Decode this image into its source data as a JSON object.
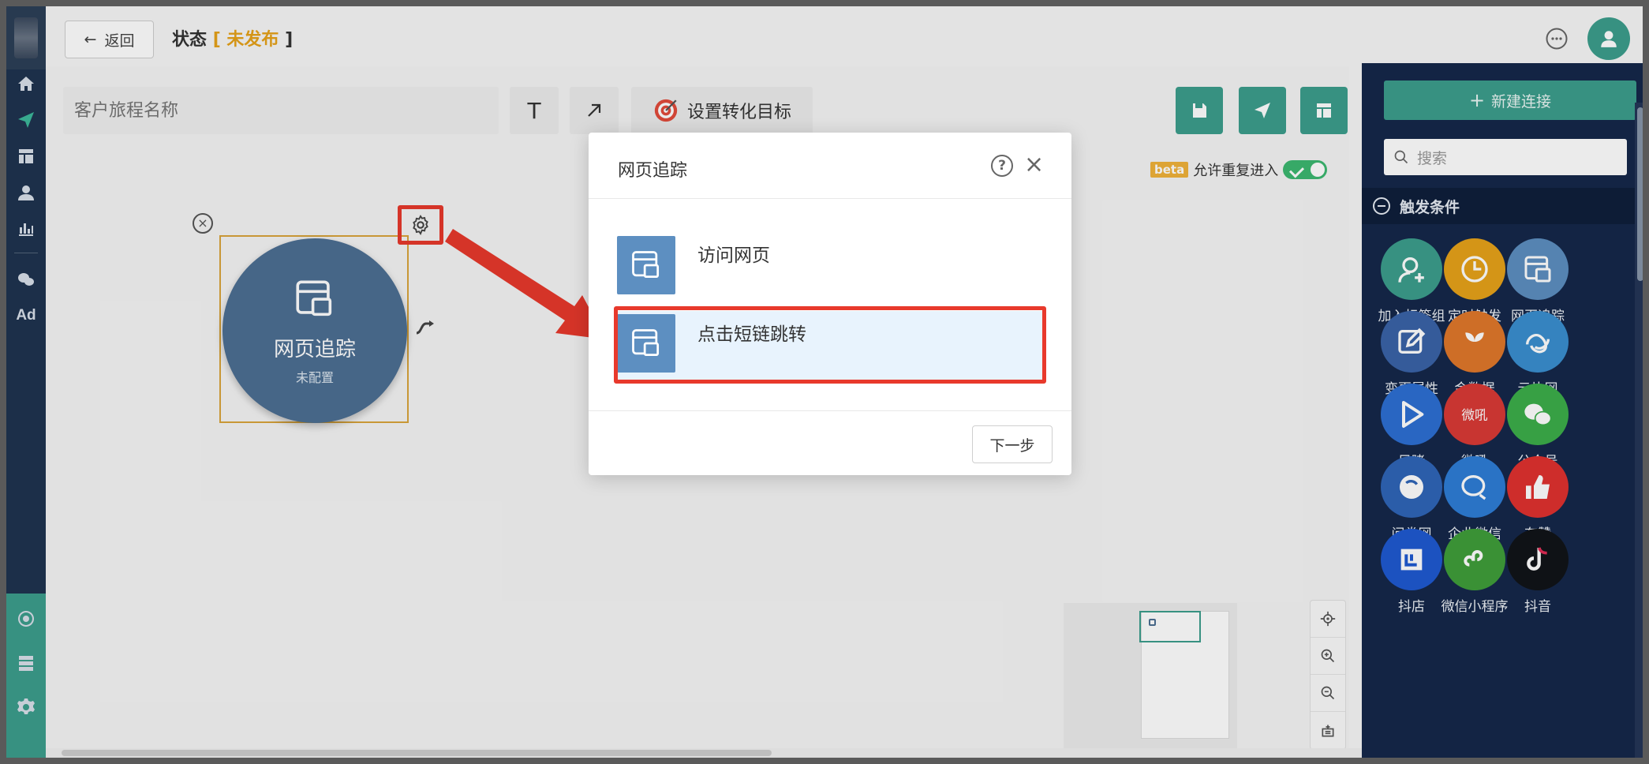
{
  "topbar": {
    "back_label": "返回",
    "status_label": "状态",
    "status_value": "未发布"
  },
  "canvas": {
    "name_placeholder": "客户旅程名称",
    "text_tool": "T",
    "conversion_goal_label": "设置转化目标",
    "beta_label": "beta",
    "allow_reentry_label": "允许重复进入",
    "allow_reentry_on": true,
    "node": {
      "title": "网页追踪",
      "subtitle": "未配置"
    }
  },
  "modal": {
    "title": "网页追踪",
    "options": [
      {
        "label": "访问网页",
        "selected": false
      },
      {
        "label": "点击短链跳转",
        "selected": true
      }
    ],
    "next_label": "下一步"
  },
  "right_panel": {
    "new_connection_label": "新建连接",
    "search_placeholder": "搜索",
    "section_title": "触发条件",
    "tiles": [
      {
        "label": "加入标签组",
        "color": "#3c9e8c",
        "icon": "user-add-icon"
      },
      {
        "label": "定时触发",
        "color": "#e6a21a",
        "icon": "clock-icon"
      },
      {
        "label": "网页追踪",
        "color": "#5d8fc1",
        "icon": "webpage-icon"
      },
      {
        "label": "变更属性",
        "color": "#3a63a8",
        "icon": "edit-icon"
      },
      {
        "label": "金数据",
        "color": "#e0782b",
        "icon": "jinshuju-icon"
      },
      {
        "label": "云片网",
        "color": "#3a8fd0",
        "icon": "yunpian-icon"
      },
      {
        "label": "目睹",
        "color": "#2d6fd3",
        "icon": "play-icon"
      },
      {
        "label": "微吼",
        "color": "#d93a36",
        "icon": "weihou-icon"
      },
      {
        "label": "公众号",
        "color": "#3cae4a",
        "icon": "wechat-icon"
      },
      {
        "label": "问卷网",
        "color": "#2f65b8",
        "icon": "wenjuan-icon"
      },
      {
        "label": "企业微信",
        "color": "#2e7dd6",
        "icon": "wecom-icon"
      },
      {
        "label": "有赞",
        "color": "#e0312f",
        "icon": "thumbs-up-icon"
      },
      {
        "label": "抖店",
        "color": "#1f5ad1",
        "icon": "doudian-icon"
      },
      {
        "label": "微信小程序",
        "color": "#3f9e3a",
        "icon": "miniprogram-icon"
      },
      {
        "label": "抖音",
        "color": "#111418",
        "icon": "tiktok-icon"
      }
    ]
  }
}
